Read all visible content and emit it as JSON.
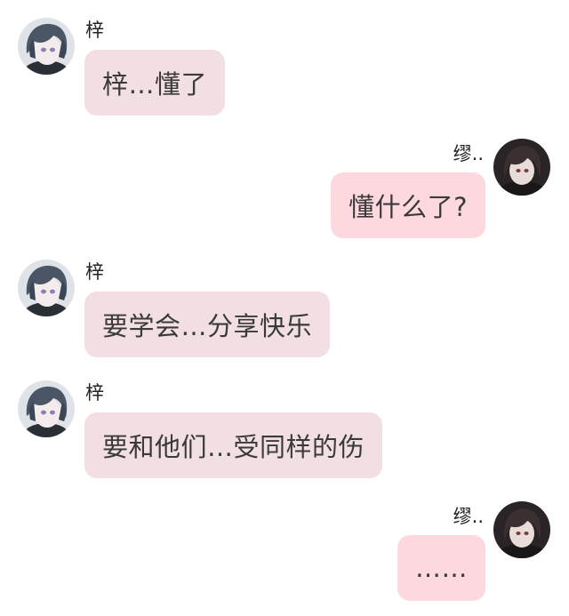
{
  "colors": {
    "left_bubble": "#f2dfe1",
    "right_bubble": "#fdd8df",
    "text": "#3a3a3a",
    "name": "#222222"
  },
  "messages": [
    {
      "side": "left",
      "sender": "梓",
      "avatar": "left-avatar-icon",
      "text": "梓…懂了"
    },
    {
      "side": "right",
      "sender": "缪..",
      "avatar": "right-avatar-icon",
      "text": "懂什么了?"
    },
    {
      "side": "left",
      "sender": "梓",
      "avatar": "left-avatar-icon",
      "text": "要学会…分享快乐"
    },
    {
      "side": "left",
      "sender": "梓",
      "avatar": "left-avatar-icon",
      "text": "要和他们…受同样的伤"
    },
    {
      "side": "right",
      "sender": "缪..",
      "avatar": "right-avatar-icon",
      "text": "……"
    }
  ]
}
